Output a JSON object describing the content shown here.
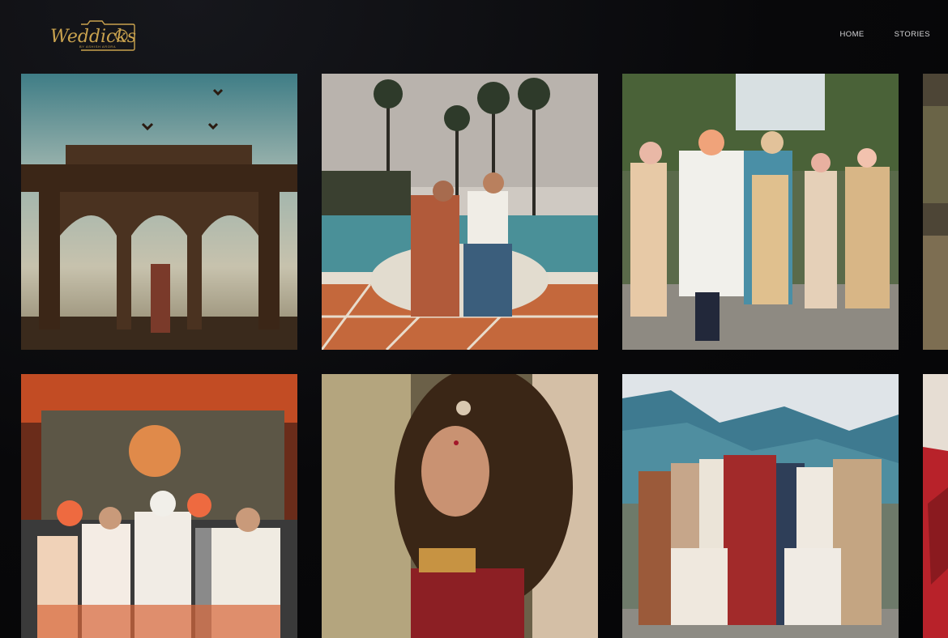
{
  "header": {
    "logo_text": "Weddicks",
    "logo_sub": "BY ASHISH ARORA",
    "nav": [
      {
        "label": "HOME"
      },
      {
        "label": "STORIES"
      }
    ]
  },
  "gallery": {
    "tiles": [
      {
        "icon": "photo-palace-pavilion"
      },
      {
        "icon": "photo-couple-poolside"
      },
      {
        "icon": "photo-groom-dance"
      },
      {
        "icon": "photo-cropped-partial"
      },
      {
        "icon": "photo-sikh-ceremony"
      },
      {
        "icon": "photo-bride-portrait"
      },
      {
        "icon": "photo-bridal-party-mountains"
      },
      {
        "icon": "photo-cropped-red"
      }
    ]
  },
  "colors": {
    "background": "#050506",
    "logo_gold": "#c9a24e",
    "nav_text": "#d6d6d8"
  }
}
